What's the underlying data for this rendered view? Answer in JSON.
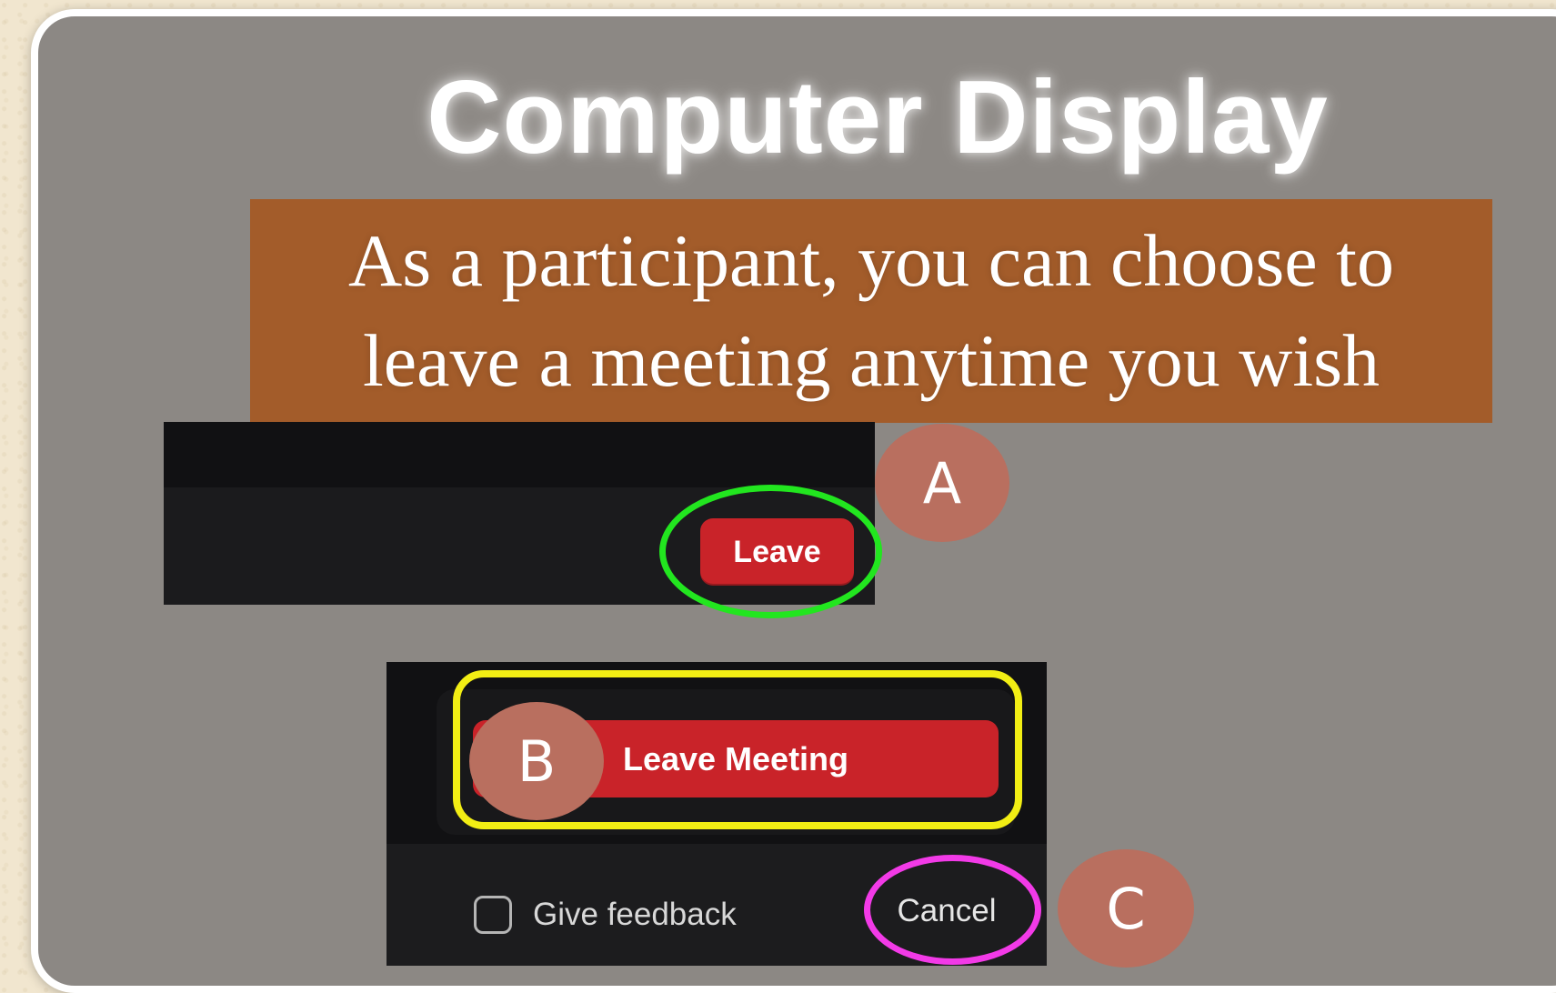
{
  "slide": {
    "title": "Computer Display",
    "banner": {
      "lines": [
        "As a participant, you can choose to",
        "leave a meeting anytime you wish"
      ]
    }
  },
  "screenshot_a": {
    "leave_button_label": "Leave",
    "marker_label": "A",
    "highlight_color": "#22e61f"
  },
  "screenshot_b": {
    "leave_meeting_button_label": "Leave Meeting",
    "marker_label": "B",
    "highlight_color": "#f2ee14",
    "feedback_checkbox_label": "Give feedback",
    "feedback_checked": false,
    "cancel_button_label": "Cancel",
    "cancel_marker_label": "C",
    "cancel_highlight_color": "#f23ae7"
  },
  "colors": {
    "panel_background": "#8c8884",
    "banner_background": "#a35c2a",
    "button_red": "#c92329",
    "marker_background": "#b96f5f"
  }
}
